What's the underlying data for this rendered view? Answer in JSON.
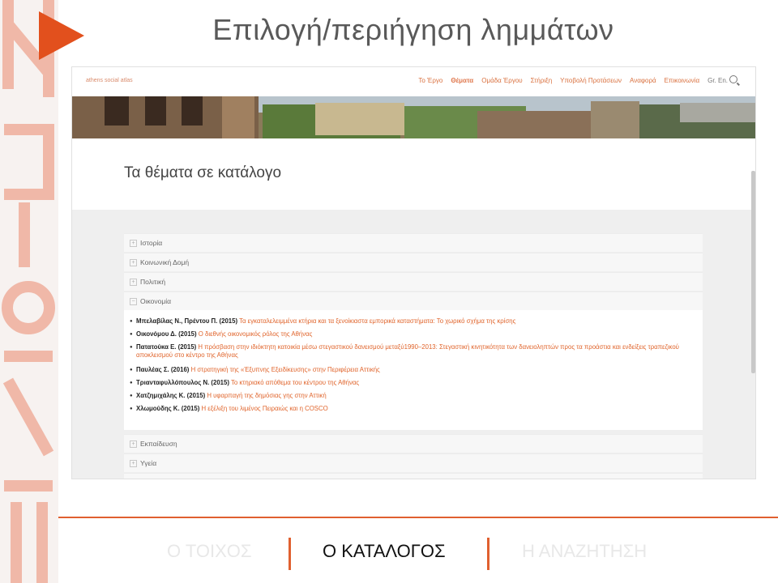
{
  "slide": {
    "title": "Επιλογή/περιήγηση λημμάτων",
    "colors": {
      "accent": "#e2501d",
      "title": "#595959"
    }
  },
  "site": {
    "logo": "athens social atlas",
    "nav": [
      "Το Έργο",
      "Θέματα",
      "Ομάδα Έργου",
      "Στήριξη",
      "Υποβολή Προτάσεων",
      "Αναφορά",
      "Επικοινωνία",
      "Gr. En."
    ],
    "active_nav": "Θέματα"
  },
  "page": {
    "heading": "Τα θέματα σε κατάλογο",
    "categories_top": [
      "Ιστορία",
      "Κοινωνική Δομή",
      "Πολιτική"
    ],
    "expanded_category": "Οικονομία",
    "references": [
      {
        "author": "Μπελαβίλας Ν., Πρέντου Π. (2015)",
        "title": "Τα εγκαταλελειμμένα κτήρια και τα ξενοίκιαστα εμπορικά καταστήματα: Το χωρικό σχήμα της κρίσης"
      },
      {
        "author": "Οικονόμου Δ. (2015)",
        "title": "Ο διεθνής οικονομικός ρόλος της Αθήνας"
      },
      {
        "author": "Πατατούκα Ε. (2015)",
        "title": "Η πρόσβαση στην ιδιόκτητη κατοικία μέσω στεγαστικού δανεισμού μεταξύ1990–2013: Στεγαστική κινητικότητα των δανειοληπτών προς τα προάστια και ενδείξεις τραπεζικού αποκλεισμού στο κέντρο της Αθήνας"
      },
      {
        "author": "Παυλέας Σ. (2016)",
        "title": "Η στρατηγική της «Έξυπνης Εξειδίκευσης» στην Περιφέρεια Αττικής"
      },
      {
        "author": "Τριανταφυλλόπουλος Ν. (2015)",
        "title": "Το κτηριακό απόθεμα του κέντρου της Αθήνας"
      },
      {
        "author": "Χατζημιχάλης Κ. (2015)",
        "title": "Η υφαρπαγή της δημόσιας γης στην Αττική"
      },
      {
        "author": "Χλωμούδης Κ. (2015)",
        "title": "Η εξέλιξη του λιμένος Πειραιώς και η COSCO"
      }
    ],
    "categories_bottom": [
      "Εκπαίδευση",
      "Υγεία"
    ]
  },
  "bottom_tabs": [
    {
      "label": "Ο ΤΟΙΧΟΣ",
      "active": false
    },
    {
      "label": "Ο ΚΑΤΑΛΟΓΟΣ",
      "active": true
    },
    {
      "label": "Η ΑΝΑΖΗΤΗΣΗ",
      "active": false
    }
  ]
}
